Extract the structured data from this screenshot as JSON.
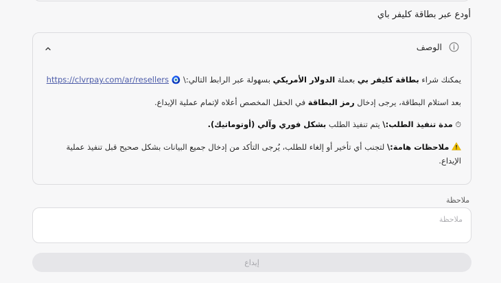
{
  "heading": "أودع عبر بطاقة كليفر باي",
  "description_card": {
    "title": "الوصف",
    "info_icon": "info-circle-icon",
    "chevron_icon": "chevron-up-icon",
    "line1": {
      "pre": "يمكنك شراء ",
      "b1": "بطاقة كليفر بي",
      "mid": " بعملة ",
      "b2": "الدولار الأمريكي",
      "post": " بسهولة عبر الرابط التالي:\\ ",
      "emoji": "🧿",
      "link": "https://clvrpay.com/ar/resellers"
    },
    "line2": {
      "pre": "بعد استلام البطاقة، يرجى إدخال ",
      "b1": "رمز البطاقة",
      "post": " في الحقل المخصص أعلاه لإتمام عملية الإيداع."
    },
    "line3": {
      "emoji": "⏱",
      "b1": "مدة تنفيذ الطلب:\\",
      "mid": " يتم تنفيذ الطلب ",
      "b2": "بشكل فوري وآلي (أوتوماتيك)."
    },
    "line4": {
      "icon": "warning-icon",
      "b1": "ملاحظات هامة:\\",
      "post": " لتجنب أي تأخير أو إلغاء للطلب، يُرجى التأكد من إدخال جميع البيانات بشكل صحيح قبل تنفيذ عملية الإيداع."
    }
  },
  "note": {
    "label": "ملاحظة",
    "placeholder": "ملاحظة",
    "value": ""
  },
  "submit_label": "إيداع",
  "colors": {
    "background": "#f7f7f8",
    "border": "#dcdcdf",
    "link": "#4a5aa8",
    "button_bg": "#e6e6e9",
    "button_text": "#a3a3a8",
    "warning": "#f2c200"
  }
}
